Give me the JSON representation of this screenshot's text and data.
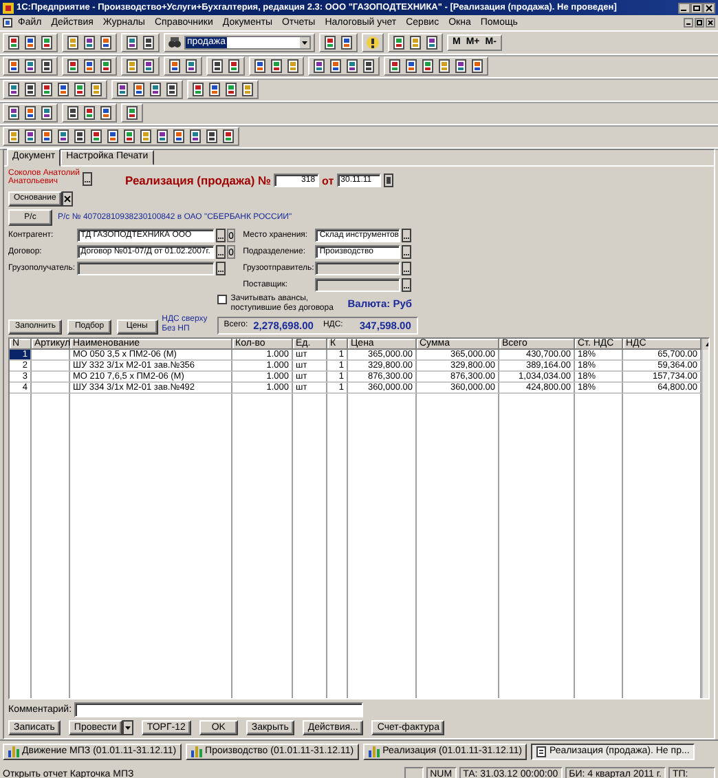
{
  "window": {
    "title": "1С:Предприятие - Производство+Услуги+Бухгалтерия, редакция 2.3: ООО \"ГАЗОПОДТЕХНИКА\" - [Реализация (продажа). Не проведен]"
  },
  "menu": [
    "Файл",
    "Действия",
    "Журналы",
    "Справочники",
    "Документы",
    "Отчеты",
    "Налоговый учет",
    "Сервис",
    "Окна",
    "Помощь"
  ],
  "toolbar": {
    "search": {
      "value": "продажа"
    },
    "memory_buttons": [
      "М",
      "М+",
      "М-"
    ]
  },
  "document": {
    "tabs": [
      {
        "label": "Документ",
        "selected": true
      },
      {
        "label": "Настройка Печати",
        "selected": false
      }
    ],
    "author": "Соколов Анатолий Анатольевич",
    "heading": "Реализация (продажа) №",
    "number": "318",
    "date_label": "от",
    "date": "30.11.11",
    "basis_button": "Основание",
    "account_button": "Р/с",
    "account_text": "Р/с № 40702810938230100842 в ОАО \"СБЕРБАНК РОССИИ\"",
    "fields_left": [
      {
        "label": "Контрагент:",
        "value": "ТД ГАЗОПОДТЕХНИКА ООО",
        "kind": "ref"
      },
      {
        "label": "Договор:",
        "value": "Договор №01-07/Д от 01.02.2007г.",
        "kind": "ref"
      },
      {
        "label": "Грузополучатель:",
        "kind": "empty"
      }
    ],
    "fields_right": [
      {
        "label": "Место хранения:",
        "value": "Склад инструментов",
        "kind": "ref"
      },
      {
        "label": "Подразделение:",
        "value": "Производство",
        "kind": "ref"
      },
      {
        "label": "Грузоотправитель:",
        "kind": "empty"
      },
      {
        "label": "Поставщик:",
        "kind": "empty"
      }
    ],
    "advance_checkbox": {
      "label": "Зачитывать авансы, поступившие без договора",
      "checked": false
    },
    "currency": "Валюта: Руб",
    "table_buttons": [
      "Заполнить",
      "Подбор",
      "Цены"
    ],
    "vat_note_lines": [
      "НДС сверху",
      "Без НП"
    ],
    "totals": {
      "total_label": "Всего:",
      "total": "2,278,698.00",
      "vat_label": "НДС:",
      "vat": "347,598.00"
    },
    "table": {
      "columns": [
        "N",
        "Артикул",
        "Наименование",
        "Кол-во",
        "Ед.",
        "К",
        "Цена",
        "Сумма",
        "Всего",
        "Ст. НДС",
        "НДС"
      ],
      "rows": [
        {
          "selected": true,
          "cells": [
            "1",
            "",
            "МО 050 3,5 х ПМ2-06 (М)",
            "1.000",
            "шт",
            "1",
            "365,000.00",
            "365,000.00",
            "430,700.00",
            "18%",
            "65,700.00"
          ]
        },
        {
          "selected": false,
          "cells": [
            "2",
            "",
            "ШУ 332 3/1х М2-01 зав.№356",
            "1.000",
            "шт",
            "1",
            "329,800.00",
            "329,800.00",
            "389,164.00",
            "18%",
            "59,364.00"
          ]
        },
        {
          "selected": false,
          "cells": [
            "3",
            "",
            "МО 210 7,6,5 х ПМ2-06 (М)",
            "1.000",
            "шт",
            "1",
            "876,300.00",
            "876,300.00",
            "1,034,034.00",
            "18%",
            "157,734.00"
          ]
        },
        {
          "selected": false,
          "cells": [
            "4",
            "",
            "ШУ 334 3/1х М2-01 зав.№492",
            "1.000",
            "шт",
            "1",
            "360,000.00",
            "360,000.00",
            "424,800.00",
            "18%",
            "64,800.00"
          ]
        }
      ]
    },
    "comment": {
      "label": "Комментарий:"
    },
    "buttons": [
      {
        "label": "Записать",
        "kind": "plain"
      },
      {
        "label": "Провести",
        "kind": "split"
      },
      {
        "label": "ТОРГ-12",
        "kind": "plain"
      },
      {
        "label": "OK",
        "kind": "plain"
      },
      {
        "label": "Закрыть",
        "kind": "plain"
      },
      {
        "label": "Действия...",
        "kind": "plain"
      },
      {
        "label": "Счет-фактура",
        "kind": "plain"
      }
    ]
  },
  "taskbar": [
    {
      "label": "Движение МПЗ (01.01.11-31.12.11)",
      "kind": "report",
      "selected": false
    },
    {
      "label": "Производство (01.01.11-31.12.11)",
      "kind": "report",
      "selected": false
    },
    {
      "label": "Реализация (01.01.11-31.12.11)",
      "kind": "report",
      "selected": false
    },
    {
      "label": "Реализация (продажа). Не пр...",
      "kind": "document",
      "selected": true
    }
  ],
  "status_bar": {
    "message": "Открыть отчет Карточка МПЗ",
    "cells": [
      "NUM",
      "ТА: 31.03.12 00:00:00",
      "БИ: 4 квартал 2011 г.",
      "ТП:"
    ]
  }
}
